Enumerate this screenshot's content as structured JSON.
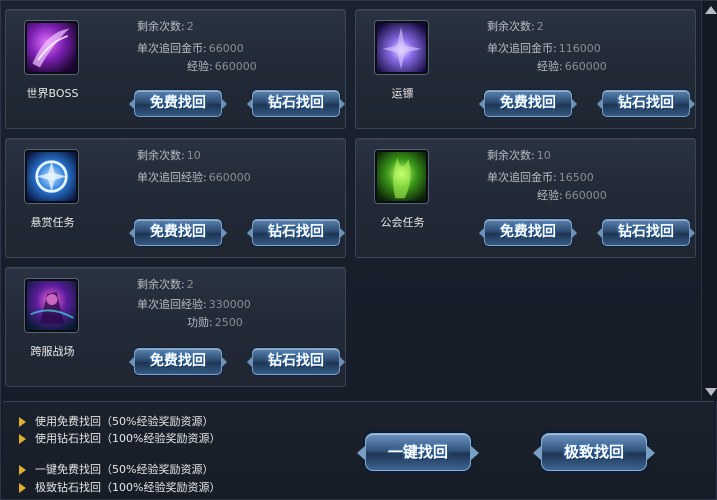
{
  "cards": [
    {
      "name": "世界BOSS",
      "icon": "world-boss-icon",
      "stats": [
        {
          "label": "剩余次数:",
          "value": "2"
        },
        {
          "label": "单次追回金币:",
          "value": "66000"
        },
        {
          "label": "经验:",
          "value": "660000"
        }
      ],
      "free_label": "免费找回",
      "diamond_label": "钻石找回"
    },
    {
      "name": "运镖",
      "icon": "escort-icon",
      "stats": [
        {
          "label": "剩余次数:",
          "value": "2"
        },
        {
          "label": "单次追回金币:",
          "value": "116000"
        },
        {
          "label": "经验:",
          "value": "660000"
        }
      ],
      "free_label": "免费找回",
      "diamond_label": "钻石找回"
    },
    {
      "name": "悬赏任务",
      "icon": "bounty-icon",
      "stats": [
        {
          "label": "剩余次数:",
          "value": "10"
        },
        {
          "label": "单次追回经验:",
          "value": "660000"
        }
      ],
      "free_label": "免费找回",
      "diamond_label": "钻石找回"
    },
    {
      "name": "公会任务",
      "icon": "guild-task-icon",
      "stats": [
        {
          "label": "剩余次数:",
          "value": "10"
        },
        {
          "label": "单次追回金币:",
          "value": "16500"
        },
        {
          "label": "经验:",
          "value": "660000"
        }
      ],
      "free_label": "免费找回",
      "diamond_label": "钻石找回"
    },
    {
      "name": "跨服战场",
      "icon": "cross-server-battle-icon",
      "stats": [
        {
          "label": "剩余次数:",
          "value": "2"
        },
        {
          "label": "单次追回经验:",
          "value": "330000"
        },
        {
          "label": "功勋:",
          "value": "2500"
        }
      ],
      "free_label": "免费找回",
      "diamond_label": "钻石找回"
    }
  ],
  "tips": [
    "使用免费找回（50%经验奖励资源）",
    "使用钻石找回（100%经验奖励资源）",
    "一键免费找回（50%经验奖励资源）",
    "极致钻石找回（100%经验奖励资源）"
  ],
  "one_click_label": "一键找回",
  "ultimate_label": "极致找回",
  "colors": {
    "tip_arrow": "#e0b030",
    "button_blue": "#2e4d72"
  }
}
